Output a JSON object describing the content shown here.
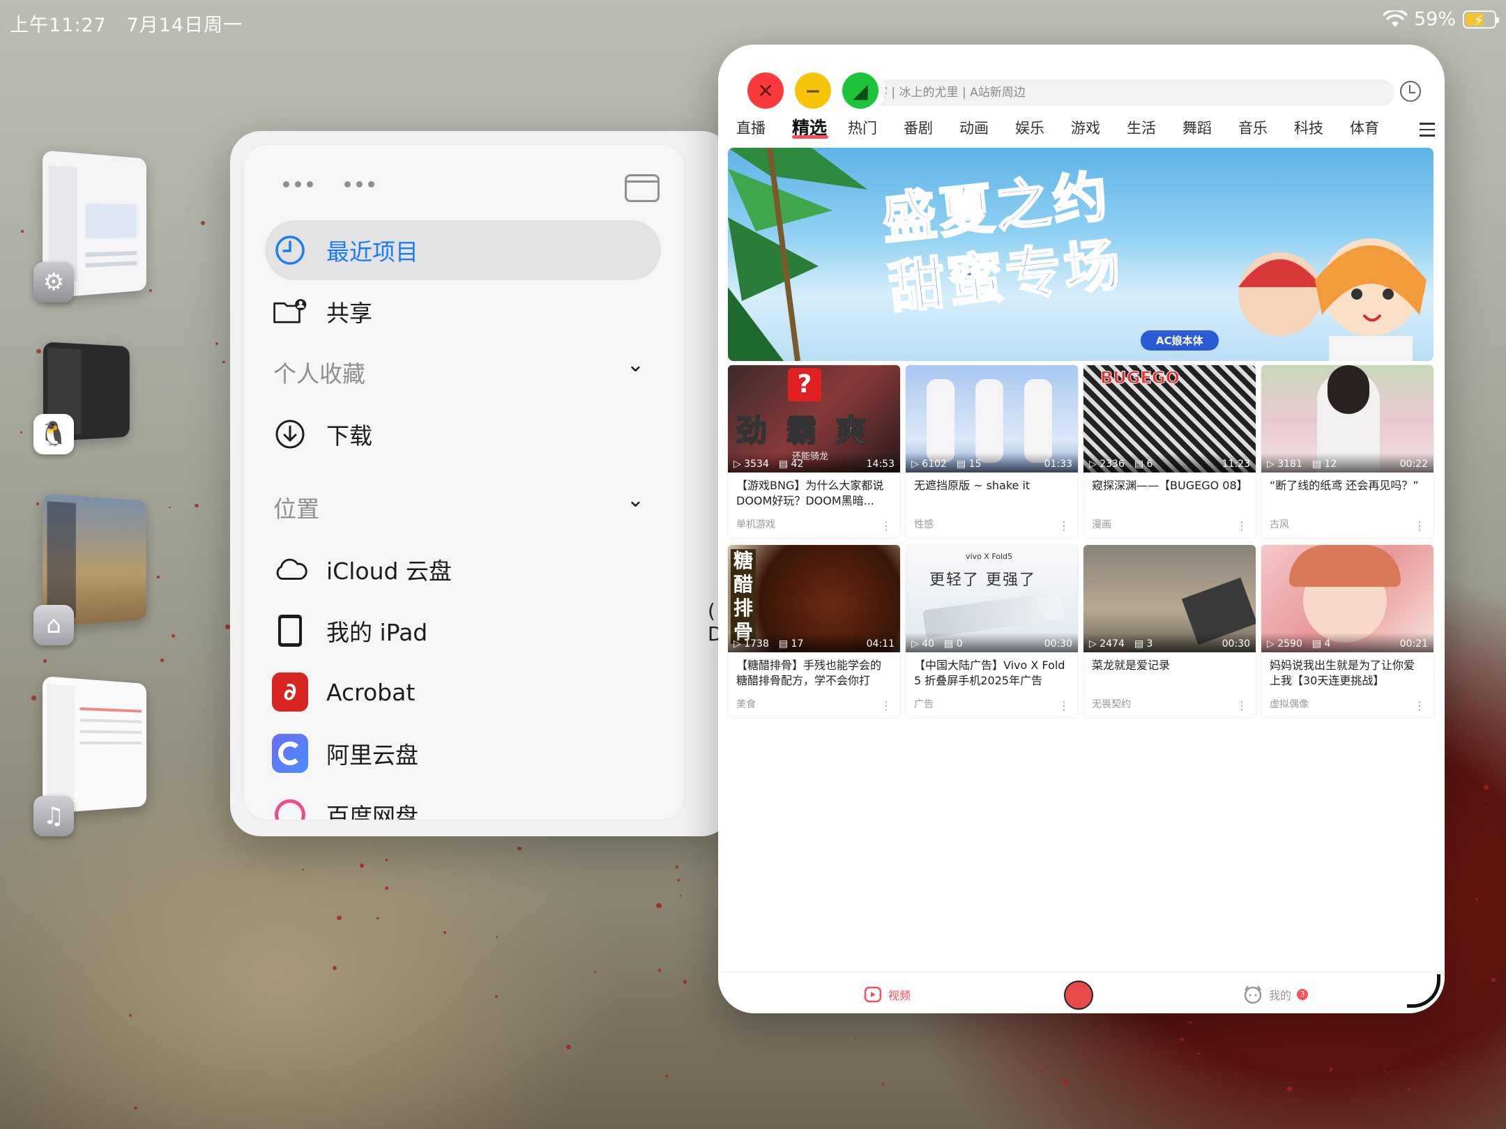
{
  "status": {
    "time": "上午11:27",
    "date": "7月14日周一",
    "battery": "59%",
    "battery_level": 0.59
  },
  "stage_manager": [
    {
      "app": "Settings",
      "icon": "settings-icon"
    },
    {
      "app": "QQ",
      "icon": "qq-icon"
    },
    {
      "app": "Home",
      "icon": "home-icon"
    },
    {
      "app": "Music",
      "icon": "music-icon"
    }
  ],
  "files": {
    "recent": "最近项目",
    "shared": "共享",
    "favorites_section": "个人收藏",
    "downloads": "下载",
    "locations_section": "位置",
    "icloud": "iCloud 云盘",
    "ipad": "我的 iPad",
    "acrobat": "Acrobat",
    "aliyun": "阿里云盘",
    "baidu": "百度网盘"
  },
  "acfun": {
    "search_placeholder": "客 | 冰上的尤里 | A站新周边",
    "tabs": [
      "直播",
      "精选",
      "热门",
      "番剧",
      "动画",
      "娱乐",
      "游戏",
      "生活",
      "舞蹈",
      "音乐",
      "科技",
      "体育"
    ],
    "active_tab": "精选",
    "banner": {
      "line1": "盛夏之约",
      "line2": "甜蜜专场",
      "tag": "AC娘本体"
    },
    "videos": [
      {
        "views": "3534",
        "comments": "42",
        "duration": "14:53",
        "title": "【游戏BNG】为什么大家都说DOOM好玩？DOOM黑暗...",
        "category": "单机游戏"
      },
      {
        "views": "6102",
        "comments": "15",
        "duration": "01:33",
        "title": "无遮挡原版 ~ shake it",
        "category": "性感"
      },
      {
        "views": "2336",
        "comments": "6",
        "duration": "11:23",
        "title": "窥探深渊——【BUGEGO 08】",
        "category": "漫画"
      },
      {
        "views": "3181",
        "comments": "12",
        "duration": "00:22",
        "title": "“断了线的纸鸢  还会再见吗？”",
        "category": "古风"
      },
      {
        "views": "1738",
        "comments": "17",
        "duration": "04:11",
        "title": "【糖醋排骨】手残也能学会的糖醋排骨配方，学不会你打电...",
        "category": "美食"
      },
      {
        "views": "40",
        "comments": "0",
        "duration": "00:30",
        "title": "【中国大陆广告】Vivo X Fold 5 折叠屏手机2025年广告",
        "category": "广告"
      },
      {
        "views": "2474",
        "comments": "3",
        "duration": "00:30",
        "title": "菜龙就是爱记录",
        "category": "无畏契约"
      },
      {
        "views": "2590",
        "comments": "4",
        "duration": "00:21",
        "title": "妈妈说我出生就是为了让你爱上我【30天连更挑战】",
        "category": "虚拟偶像"
      }
    ],
    "thumb_texts": {
      "t1": "劲 霸 爽",
      "t1_sub": "还能骑龙",
      "t3": "BUGEGO",
      "t5": "糖醋排骨",
      "t6_brand": "vivo X Fold5",
      "t6": "更轻了  更强了"
    },
    "bottom": {
      "video": "视频",
      "mine": "我的",
      "mine_badge": "3"
    }
  }
}
